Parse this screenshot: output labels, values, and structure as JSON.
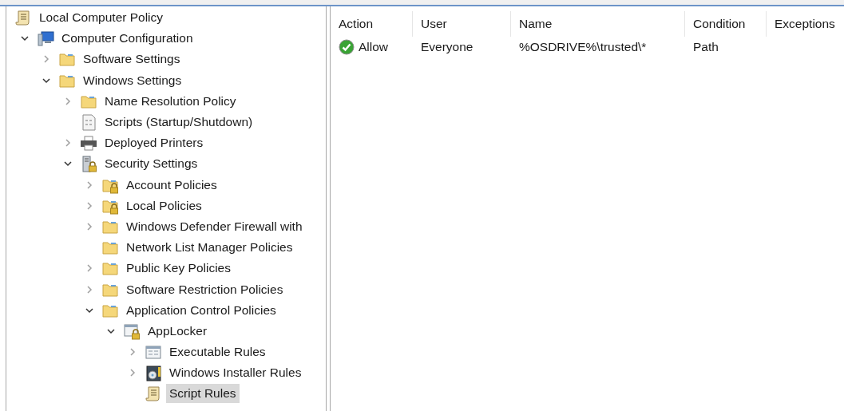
{
  "tree": [
    {
      "label": "Local Computer Policy",
      "kind": "scroll",
      "selected": false,
      "children": [
        {
          "label": "Computer Configuration",
          "kind": "computer",
          "expanded": true,
          "selected": false,
          "children": [
            {
              "label": "Software Settings",
              "kind": "folder",
              "expanded": false,
              "selected": false
            },
            {
              "label": "Windows Settings",
              "kind": "folder",
              "expanded": true,
              "selected": false,
              "children": [
                {
                  "label": "Name Resolution Policy",
                  "kind": "folder",
                  "expanded": false,
                  "selected": false
                },
                {
                  "label": "Scripts (Startup/Shutdown)",
                  "kind": "script",
                  "selected": false
                },
                {
                  "label": "Deployed Printers",
                  "kind": "printer",
                  "expanded": false,
                  "selected": false
                },
                {
                  "label": "Security Settings",
                  "kind": "server-lock",
                  "expanded": true,
                  "selected": false,
                  "children": [
                    {
                      "label": "Account Policies",
                      "kind": "folder-lock",
                      "expanded": false,
                      "selected": false
                    },
                    {
                      "label": "Local Policies",
                      "kind": "folder-lock",
                      "expanded": false,
                      "selected": false
                    },
                    {
                      "label": "Windows Defender Firewall with",
                      "kind": "folder",
                      "expanded": false,
                      "selected": false
                    },
                    {
                      "label": "Network List Manager Policies",
                      "kind": "folder",
                      "selected": false
                    },
                    {
                      "label": "Public Key Policies",
                      "kind": "folder",
                      "expanded": false,
                      "selected": false
                    },
                    {
                      "label": "Software Restriction Policies",
                      "kind": "folder",
                      "expanded": false,
                      "selected": false
                    },
                    {
                      "label": "Application Control Policies",
                      "kind": "folder",
                      "expanded": true,
                      "selected": false,
                      "children": [
                        {
                          "label": "AppLocker",
                          "kind": "window-lock",
                          "expanded": true,
                          "selected": false,
                          "children": [
                            {
                              "label": "Executable Rules",
                              "kind": "window",
                              "expanded": false,
                              "selected": false
                            },
                            {
                              "label": "Windows Installer Rules",
                              "kind": "installer",
                              "expanded": false,
                              "selected": false
                            },
                            {
                              "label": "Script Rules",
                              "kind": "scroll",
                              "selected": true
                            }
                          ]
                        }
                      ]
                    }
                  ]
                }
              ]
            }
          ]
        }
      ]
    }
  ],
  "table": {
    "columns": [
      "Action",
      "User",
      "Name",
      "Condition",
      "Exceptions"
    ],
    "rows": [
      {
        "action": "Allow",
        "kind": "allow",
        "user": "Everyone",
        "name": "%OSDRIVE%\\trusted\\*",
        "condition": "Path"
      }
    ]
  }
}
